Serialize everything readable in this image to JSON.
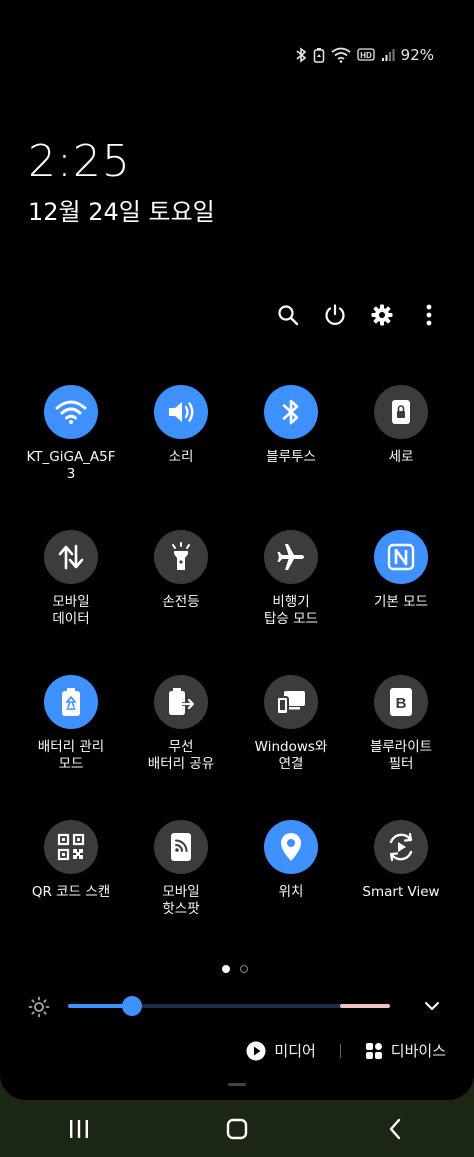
{
  "status_bar": {
    "battery_percent": "92%",
    "icons": [
      "bluetooth-icon",
      "battery-care-icon",
      "wifi-icon",
      "hd-voice-icon",
      "signal-icon"
    ]
  },
  "clock": {
    "time": "2:25",
    "date": "12월 24일 토요일"
  },
  "header_actions": [
    "search-icon",
    "power-icon",
    "gear-icon",
    "more-vert-icon"
  ],
  "colors": {
    "tile_on": "#3e91ff",
    "tile_off": "#3c3c3c",
    "panel_bg": "#000000"
  },
  "tiles": [
    {
      "label": "KT_GiGA_A5F\n3",
      "icon": "wifi-icon",
      "on": true
    },
    {
      "label": "소리",
      "icon": "volume-icon",
      "on": true
    },
    {
      "label": "블루투스",
      "icon": "bluetooth-icon",
      "on": true
    },
    {
      "label": "세로",
      "icon": "portrait-lock-icon",
      "on": false
    },
    {
      "label": "모바일\n데이터",
      "icon": "mobile-data-icon",
      "on": false
    },
    {
      "label": "손전등",
      "icon": "flashlight-icon",
      "on": false
    },
    {
      "label": "비행기\n탑승 모드",
      "icon": "airplane-icon",
      "on": false
    },
    {
      "label": "기본 모드",
      "icon": "nfc-icon",
      "on": true
    },
    {
      "label": "배터리 관리\n모드",
      "icon": "battery-saver-icon",
      "on": true
    },
    {
      "label": "무선\n배터리 공유",
      "icon": "wireless-powershare-icon",
      "on": false
    },
    {
      "label": "Windows와\n연결",
      "icon": "link-to-windows-icon",
      "on": false
    },
    {
      "label": "블루라이트\n필터",
      "icon": "blue-light-filter-icon",
      "on": false
    },
    {
      "label": "QR 코드 스캔",
      "icon": "qr-scan-icon",
      "on": false
    },
    {
      "label": "모바일\n핫스팟",
      "icon": "hotspot-icon",
      "on": false
    },
    {
      "label": "위치",
      "icon": "location-icon",
      "on": true
    },
    {
      "label": "Smart View",
      "icon": "smart-view-icon",
      "on": false
    }
  ],
  "pager": {
    "pages": 2,
    "current": 1
  },
  "brightness": {
    "level": 0.2
  },
  "bottom_actions": {
    "media_label": "미디어",
    "devices_label": "디바이스"
  },
  "nav_bar": [
    "recents-icon",
    "home-icon",
    "back-icon"
  ]
}
